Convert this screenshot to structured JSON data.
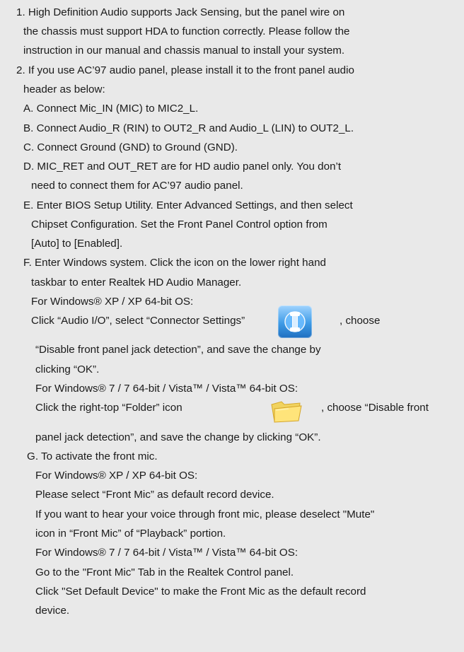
{
  "lines": [
    "1. High Definition Audio supports Jack Sensing, but the panel wire on",
    "the chassis must support HDA to function correctly. Please follow the",
    "instruction in our manual and chassis manual to install your system.",
    "2. If you use AC’97 audio panel, please install it to the front panel audio",
    "header as below:",
    "A. Connect Mic_IN (MIC) to MIC2_L.",
    "B. Connect Audio_R (RIN) to OUT2_R and Audio_L (LIN) to OUT2_L.",
    "C. Connect Ground (GND) to Ground (GND).",
    "D. MIC_RET and OUT_RET are for HD audio panel only. You don’t",
    "need to connect them for AC’97 audio panel.",
    "E. Enter BIOS Setup Utility. Enter Advanced Settings, and then select",
    "Chipset Configuration. Set the Front Panel Control option from",
    "[Auto] to [Enabled].",
    "F. Enter Windows system. Click the icon on the lower right hand",
    "taskbar to enter Realtek HD Audio Manager.",
    "For Windows® XP / XP 64-bit OS:",
    "Click “Audio I/O”, select “Connector Settings”",
    ", choose",
    "“Disable front panel jack detection”, and save the change by",
    "clicking “OK”.",
    "For Windows® 7 / 7 64-bit / Vista™ / Vista™ 64-bit OS:",
    "Click the right-top “Folder” icon",
    ", choose “Disable front",
    "panel jack detection”, and save the change by clicking “OK”.",
    "G. To activate the front mic.",
    "For Windows® XP / XP 64-bit OS:",
    "Please select “Front Mic” as default record device.",
    "If you want to hear your voice through front mic, please deselect \"Mute\"",
    "icon in “Front Mic” of “Playback” portion.",
    "For Windows® 7 / 7 64-bit / Vista™ / Vista™ 64-bit OS:",
    "Go to the \"Front Mic\" Tab in the Realtek Control panel.",
    "Click \"Set Default Device\" to make the Front Mic as the default record",
    "device."
  ],
  "icons": {
    "connector_settings": "connector-settings-icon",
    "folder": "folder-icon"
  }
}
